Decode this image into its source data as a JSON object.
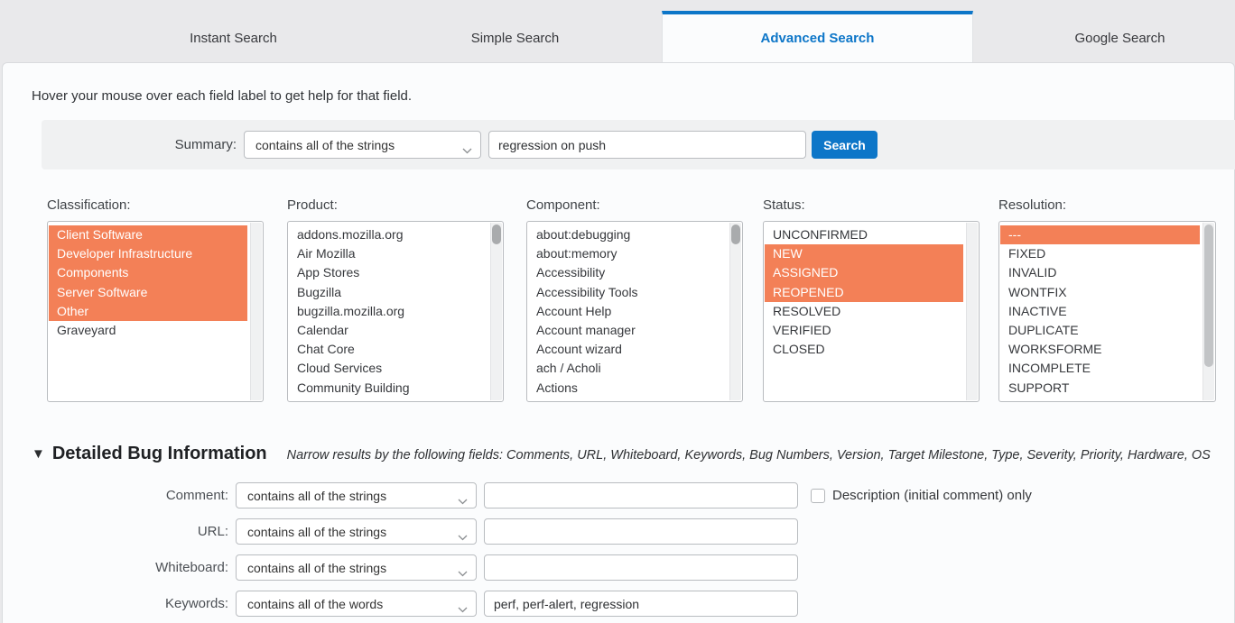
{
  "colors": {
    "accent_blue": "#0d76c8",
    "selection_orange": "#f38057"
  },
  "tabs": [
    {
      "label": "Instant Search",
      "active": false
    },
    {
      "label": "Simple Search",
      "active": false
    },
    {
      "label": "Advanced Search",
      "active": true
    },
    {
      "label": "Google Search",
      "active": false
    }
  ],
  "help_text": "Hover your mouse over each field label to get help for that field.",
  "summary": {
    "label": "Summary:",
    "operator": "contains all of the strings",
    "value": "regression on push",
    "search_button": "Search"
  },
  "fields": [
    {
      "label": "Classification:",
      "options": [
        {
          "text": "Client Software",
          "selected": true
        },
        {
          "text": "Developer Infrastructure",
          "selected": true
        },
        {
          "text": "Components",
          "selected": true
        },
        {
          "text": "Server Software",
          "selected": true
        },
        {
          "text": "Other",
          "selected": true
        },
        {
          "text": "Graveyard",
          "selected": false
        }
      ]
    },
    {
      "label": "Product:",
      "options": [
        {
          "text": "addons.mozilla.org",
          "selected": false
        },
        {
          "text": "Air Mozilla",
          "selected": false
        },
        {
          "text": "App Stores",
          "selected": false
        },
        {
          "text": "Bugzilla",
          "selected": false
        },
        {
          "text": "bugzilla.mozilla.org",
          "selected": false
        },
        {
          "text": "Calendar",
          "selected": false
        },
        {
          "text": "Chat Core",
          "selected": false
        },
        {
          "text": "Cloud Services",
          "selected": false
        },
        {
          "text": "Community Building",
          "selected": false
        }
      ]
    },
    {
      "label": "Component:",
      "options": [
        {
          "text": "about:debugging",
          "selected": false
        },
        {
          "text": "about:memory",
          "selected": false
        },
        {
          "text": "Accessibility",
          "selected": false
        },
        {
          "text": "Accessibility Tools",
          "selected": false
        },
        {
          "text": "Account Help",
          "selected": false
        },
        {
          "text": "Account manager",
          "selected": false
        },
        {
          "text": "Account wizard",
          "selected": false
        },
        {
          "text": "ach / Acholi",
          "selected": false
        },
        {
          "text": "Actions",
          "selected": false
        }
      ]
    },
    {
      "label": "Status:",
      "options": [
        {
          "text": "UNCONFIRMED",
          "selected": false
        },
        {
          "text": "NEW",
          "selected": true
        },
        {
          "text": "ASSIGNED",
          "selected": true
        },
        {
          "text": "REOPENED",
          "selected": true
        },
        {
          "text": "RESOLVED",
          "selected": false
        },
        {
          "text": "VERIFIED",
          "selected": false
        },
        {
          "text": "CLOSED",
          "selected": false
        }
      ]
    },
    {
      "label": "Resolution:",
      "options": [
        {
          "text": "---",
          "selected": true
        },
        {
          "text": "FIXED",
          "selected": false
        },
        {
          "text": "INVALID",
          "selected": false
        },
        {
          "text": "WONTFIX",
          "selected": false
        },
        {
          "text": "INACTIVE",
          "selected": false
        },
        {
          "text": "DUPLICATE",
          "selected": false
        },
        {
          "text": "WORKSFORME",
          "selected": false
        },
        {
          "text": "INCOMPLETE",
          "selected": false
        },
        {
          "text": "SUPPORT",
          "selected": false
        }
      ]
    }
  ],
  "detailed_section": {
    "collapse_icon": "▼",
    "title": "Detailed Bug Information",
    "subtitle": "Narrow results by the following fields: Comments, URL, Whiteboard, Keywords, Bug Numbers, Version, Target Milestone, Type, Severity, Priority, Hardware, OS",
    "rows": [
      {
        "label": "Comment:",
        "operator": "contains all of the strings",
        "value": ""
      },
      {
        "label": "URL:",
        "operator": "contains all of the strings",
        "value": ""
      },
      {
        "label": "Whiteboard:",
        "operator": "contains all of the strings",
        "value": ""
      },
      {
        "label": "Keywords:",
        "operator": "contains all of the words",
        "value": "perf, perf-alert, regression"
      }
    ],
    "description_checkbox": {
      "label": "Description (initial comment) only",
      "checked": false
    }
  }
}
